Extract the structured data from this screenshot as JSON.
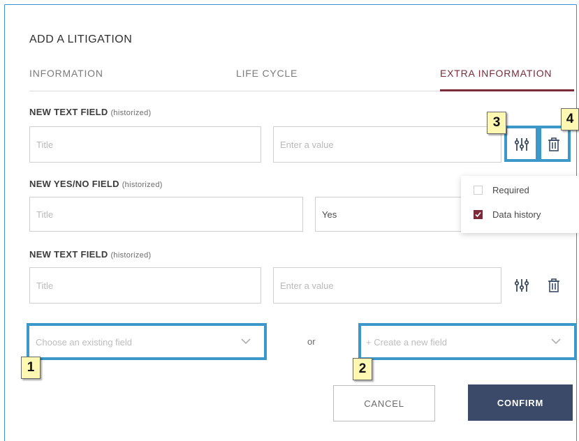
{
  "dialog": {
    "title": "ADD A LITIGATION",
    "tabs": [
      {
        "label": "INFORMATION",
        "active": false
      },
      {
        "label": "LIFE CYCLE",
        "active": false
      },
      {
        "label": "EXTRA INFORMATION",
        "active": true
      }
    ]
  },
  "fields": [
    {
      "label": "NEW TEXT FIELD",
      "suffix": "(historized)",
      "title_placeholder": "Title",
      "value_placeholder": "Enter a value",
      "value": ""
    },
    {
      "label": "NEW YES/NO FIELD",
      "suffix": "(historized)",
      "title_placeholder": "Title",
      "value": "Yes"
    },
    {
      "label": "NEW TEXT FIELD",
      "suffix": "(historized)",
      "title_placeholder": "Title",
      "value_placeholder": "Enter a value",
      "value": ""
    }
  ],
  "popover": {
    "options": [
      {
        "label": "Required",
        "checked": false
      },
      {
        "label": "Data history",
        "checked": true
      }
    ]
  },
  "add_field": {
    "existing_placeholder": "Choose an existing field",
    "or_text": "or",
    "create_placeholder": "+ Create a new field"
  },
  "callouts": [
    "1",
    "2",
    "3",
    "4"
  ],
  "buttons": {
    "cancel": "CANCEL",
    "confirm": "CONFIRM"
  },
  "colors": {
    "accent": "#7b2a3a",
    "confirm_bg": "#3c4a6a",
    "callout_border": "#3b98c9",
    "badge_bg": "#fff8b3"
  },
  "icons": [
    "settings-sliders-icon",
    "trash-icon",
    "chevron-down-icon",
    "checkmark-icon"
  ]
}
